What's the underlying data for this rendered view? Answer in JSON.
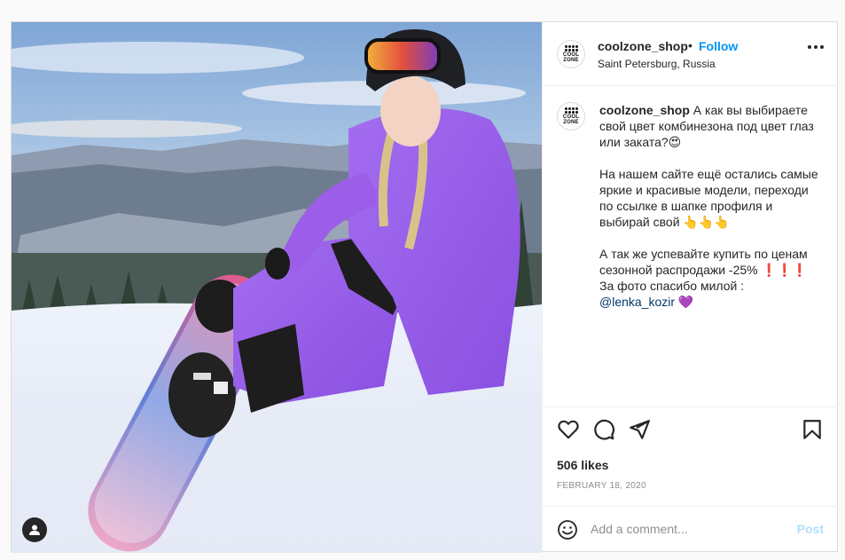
{
  "post": {
    "username": "coolzone_shop",
    "follow_label": "Follow",
    "separator": "•",
    "location": "Saint Petersburg, Russia",
    "avatar_text": "COOL ZONE",
    "caption_text": "А как вы выбираете свой цвет комбинезона под цвет глаз или заката?😍\n\nНа нашем сайте ещё остались самые яркие и красивые модели, переходи по ссылке в шапке профиля и выбирай свой 👆👆👆\n\nА так же успевайте купить по ценам сезонной распродажи -25% ❗❗❗\nЗа фото спасибо милой :\n",
    "mention": "@lenka_kozir",
    "caption_end": " 💜",
    "likes": "506 likes",
    "date": "FEBRUARY 18, 2020",
    "comment_placeholder": "Add a comment...",
    "post_label": "Post"
  },
  "icons": {
    "like": "heart-icon",
    "comment": "comment-icon",
    "share": "paper-plane-icon",
    "save": "bookmark-icon",
    "more": "more-options-icon",
    "emoji": "smiley-icon",
    "user_tag": "user-tag-icon"
  },
  "colors": {
    "link": "#0095f6",
    "post_disabled": "#b2dffc",
    "suit": "#9b5de5",
    "text": "#262626"
  }
}
